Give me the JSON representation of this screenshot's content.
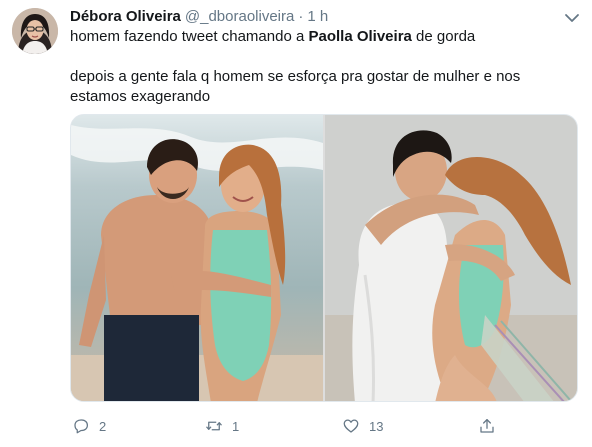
{
  "tweet": {
    "author_name": "Débora Oliveira",
    "handle": "@_dboraoliveira",
    "separator": "·",
    "time": "1 h",
    "text1_pre": "homem fazendo tweet chamando a ",
    "text1_bold": "Paolla Oliveira",
    "text1_post": " de gorda",
    "text2": "depois a gente fala q homem se esforça pra gostar de mulher e nos estamos exagerando"
  },
  "actions": {
    "reply_count": "2",
    "retweet_count": "1",
    "like_count": "13"
  },
  "icons": {
    "avatar": "avatar-photo",
    "caret": "chevron-down-icon",
    "reply": "reply-icon",
    "retweet": "retweet-icon",
    "like": "heart-icon",
    "share": "share-icon"
  },
  "colors": {
    "text": "#14171a",
    "secondary": "#657786",
    "border": "#e1e8ed"
  }
}
